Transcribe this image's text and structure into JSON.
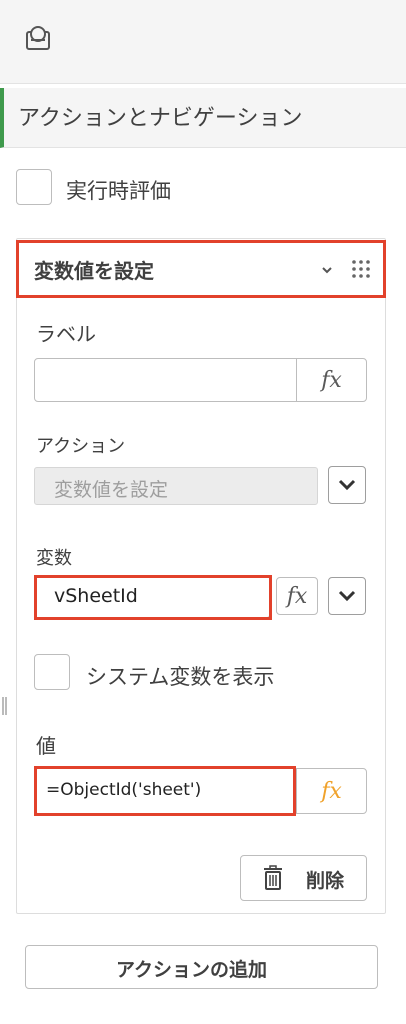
{
  "toolbar": {
    "icon": "object-properties-icon"
  },
  "section": {
    "title": "アクションとナビゲーション"
  },
  "run_time_eval": {
    "label": "実行時評価",
    "checked": false
  },
  "action_card": {
    "title": "変数値を設定",
    "label_field": {
      "label": "ラベル",
      "value": "",
      "fx": "fx"
    },
    "action_field": {
      "label": "アクション",
      "value": "変数値を設定"
    },
    "variable_field": {
      "label": "変数",
      "value": "vSheetId",
      "fx": "fx"
    },
    "show_system_vars": {
      "label": "システム変数を表示",
      "checked": false
    },
    "value_field": {
      "label": "値",
      "value": "=ObjectId('sheet')",
      "fx": "fx"
    },
    "delete_button": "削除"
  },
  "add_action_button": "アクションの追加",
  "colors": {
    "highlight": "#e2412b",
    "accent_green": "#3f9a4c",
    "fx_orange": "#f0a22b"
  }
}
